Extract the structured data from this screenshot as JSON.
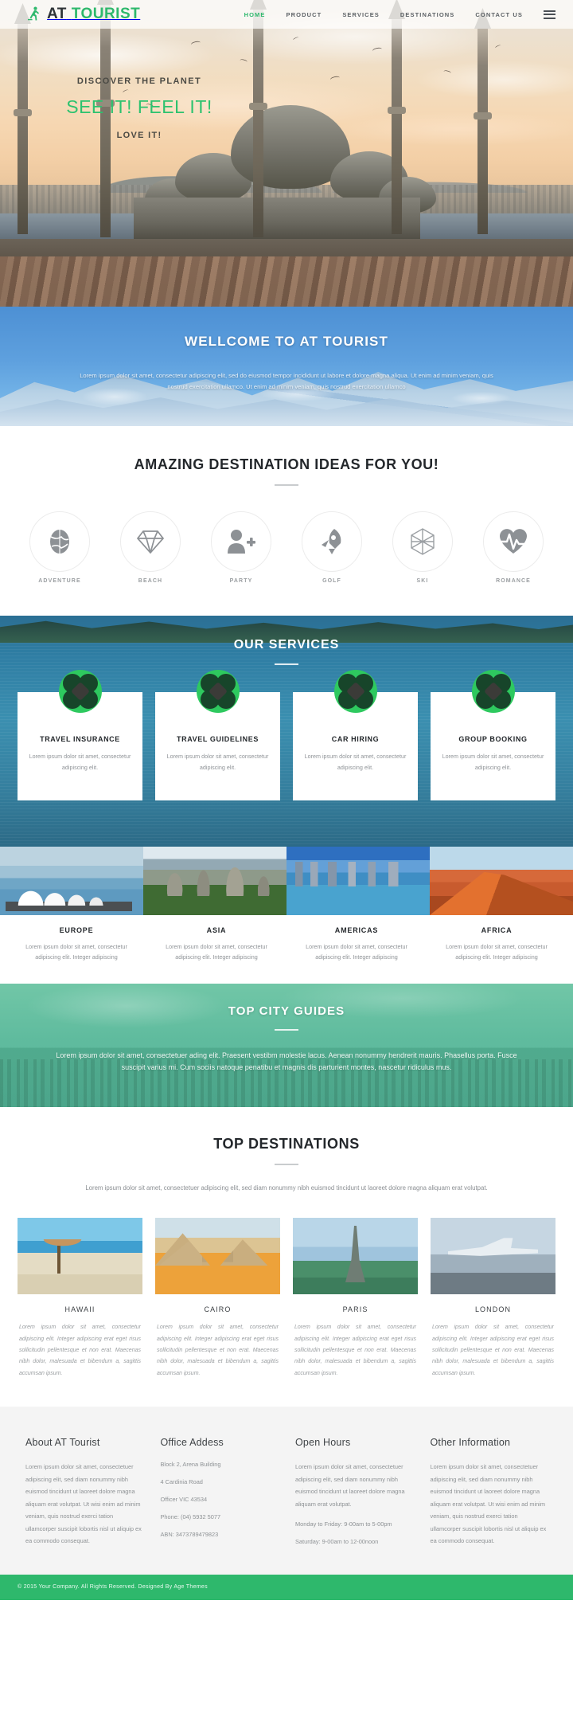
{
  "brand": {
    "part1": "AT",
    "part2": "TOURIST",
    "icon": "hiker-icon"
  },
  "nav": {
    "items": [
      {
        "label": "HOME",
        "active": true
      },
      {
        "label": "PRODUCT",
        "active": false
      },
      {
        "label": "SERVICES",
        "active": false
      },
      {
        "label": "DESTINATIONS",
        "active": false
      },
      {
        "label": "CONTACT US",
        "active": false
      }
    ],
    "menu_icon": "hamburger-menu-icon"
  },
  "hero": {
    "kicker": "DISCOVER THE PLANET",
    "title": "SEE IT! FEEL IT!",
    "subtitle": "LOVE IT!"
  },
  "welcome": {
    "title": "WELLCOME TO AT TOURIST",
    "text": "Lorem ipsum dolor sit amet, consectetur adipiscing elit, sed do eiusmod tempor incididunt ut labore et dolore magna aliqua. Ut enim ad minim veniam, quis nostrud exercitation ullamco. Ut enim ad minim veniam, quis nostrud exercitation ullamco"
  },
  "ideas": {
    "title": "AMAZING DESTINATION IDEAS FOR YOU!",
    "items": [
      {
        "label": "ADVENTURE",
        "icon": "globe-icon"
      },
      {
        "label": "BEACH",
        "icon": "diamond-icon"
      },
      {
        "label": "PARTY",
        "icon": "add-person-icon"
      },
      {
        "label": "GOLF",
        "icon": "rocket-icon"
      },
      {
        "label": "SKI",
        "icon": "hexagon-outline-icon"
      },
      {
        "label": "ROMANCE",
        "icon": "heartbeat-icon"
      }
    ]
  },
  "services": {
    "title": "OUR SERVICES",
    "cards": [
      {
        "title": "TRAVEL INSURANCE",
        "text": "Lorem ipsum dolor sit amet, consectetur adipiscing elit.",
        "icon": "clover-icon"
      },
      {
        "title": "TRAVEL GUIDELINES",
        "text": "Lorem ipsum dolor sit amet, consectetur adipiscing elit.",
        "icon": "clover-icon"
      },
      {
        "title": "CAR HIRING",
        "text": "Lorem ipsum dolor sit amet, consectetur adipiscing elit.",
        "icon": "clover-icon"
      },
      {
        "title": "GROUP BOOKING",
        "text": "Lorem ipsum dolor sit amet, consectetur adipiscing elit.",
        "icon": "clover-icon"
      }
    ]
  },
  "continents": [
    {
      "name": "EUROPE",
      "desc": "Lorem ipsum dolor sit amet, consectetur adipiscing elit. Integer adipiscing",
      "photo": "sydney-opera-house-photo"
    },
    {
      "name": "ASIA",
      "desc": "Lorem ipsum dolor sit amet, consectetur adipiscing elit. Integer adipiscing",
      "photo": "meteora-cliffs-photo"
    },
    {
      "name": "AMERICAS",
      "desc": "Lorem ipsum dolor sit amet, consectetur adipiscing elit. Integer adipiscing",
      "photo": "harbour-skyline-photo"
    },
    {
      "name": "AFRICA",
      "desc": "Lorem ipsum dolor sit amet, consectetur adipiscing elit. Integer adipiscing",
      "photo": "desert-dune-photo"
    }
  ],
  "guides": {
    "title": "TOP CITY GUIDES",
    "text": "Lorem ipsum dolor sit amet, consectetuer ading elit. Praesent vestibm molestie lacus. Aenean nonummy hendrerit mauris. Phasellus porta. Fusce suscipit varius mi. Cum sociis natoque penatibu et magnis dis parturient montes, nascetur ridiculus mus."
  },
  "destinations": {
    "title": "TOP DESTINATIONS",
    "intro": "Lorem ipsum dolor sit amet, consectetuer adipiscing elit, sed diam nonummy nibh euismod tincidunt ut laoreet dolore magna aliquam erat volutpat.",
    "items": [
      {
        "name": "HAWAII",
        "desc": "Lorem ipsum dolor sit amet, consectetur adipiscing elit. Integer adipiscing erat eget risus sollicitudin pellentesque et non erat. Maecenas nibh dolor, malesuada et bibendum a, sagittis accumsan ipsum.",
        "photo": "beach-umbrella-photo"
      },
      {
        "name": "CAIRO",
        "desc": "Lorem ipsum dolor sit amet, consectetur adipiscing elit. Integer adipiscing erat eget risus sollicitudin pellentesque et non erat. Maecenas nibh dolor, malesuada et bibendum a, sagittis accumsan ipsum.",
        "photo": "pyramids-photo"
      },
      {
        "name": "PARIS",
        "desc": "Lorem ipsum dolor sit amet, consectetur adipiscing elit. Integer adipiscing erat eget risus sollicitudin pellentesque et non erat. Maecenas nibh dolor, malesuada et bibendum a, sagittis accumsan ipsum.",
        "photo": "eiffel-tower-photo"
      },
      {
        "name": "LONDON",
        "desc": "Lorem ipsum dolor sit amet, consectetur adipiscing elit. Integer adipiscing erat eget risus sollicitudin pellentesque et non erat. Maecenas nibh dolor, malesuada et bibendum a, sagittis accumsan ipsum.",
        "photo": "airplane-photo"
      }
    ]
  },
  "footer": {
    "about": {
      "title": "About AT Tourist",
      "text": "Lorem ipsum dolor sit amet, consectetuer adipiscing elit, sed diam nonummy nibh euismod tincidunt ut laoreet dolore magna aliquam erat volutpat. Ut wisi enim ad minim veniam, quis nostrud exerci tation ullamcorper suscipit lobortis nisl ut aliquip ex ea commodo consequat."
    },
    "address": {
      "title": "Office Addess",
      "lines": [
        "Block 2, Arena Building",
        "4 Cardinia Road",
        "Officer VIC 43534",
        "Phone: (04) 5932 5077",
        "ABN: 3473789479823"
      ]
    },
    "hours": {
      "title": "Open Hours",
      "text": "Lorem ipsum dolor sit amet, consectetuer adipiscing elit, sed diam nonummy nibh euismod tincidunt ut laoreet dolore magna aliquam erat volutpat.",
      "lines": [
        "Monday to Friday: 9-00am to 5-00pm",
        "Saturday: 9-00am to 12-00noon"
      ]
    },
    "other": {
      "title": "Other Information",
      "text": "Lorem ipsum dolor sit amet, consectetuer adipiscing elit, sed diam nonummy nibh euismod tincidunt ut laoreet dolore magna aliquam erat volutpat. Ut wisi enim ad minim veniam, quis nostrud exerci tation ullamcorper suscipit lobortis nisl ut aliquip ex ea commodo consequat."
    },
    "copyright": "© 2015 Your Company. All Rights Reserved. Designed By Age Themes"
  },
  "colors": {
    "accent": "#2eb86c",
    "accent_light": "#2cc26e",
    "dark": "#23272b",
    "muted": "#8f9397"
  }
}
